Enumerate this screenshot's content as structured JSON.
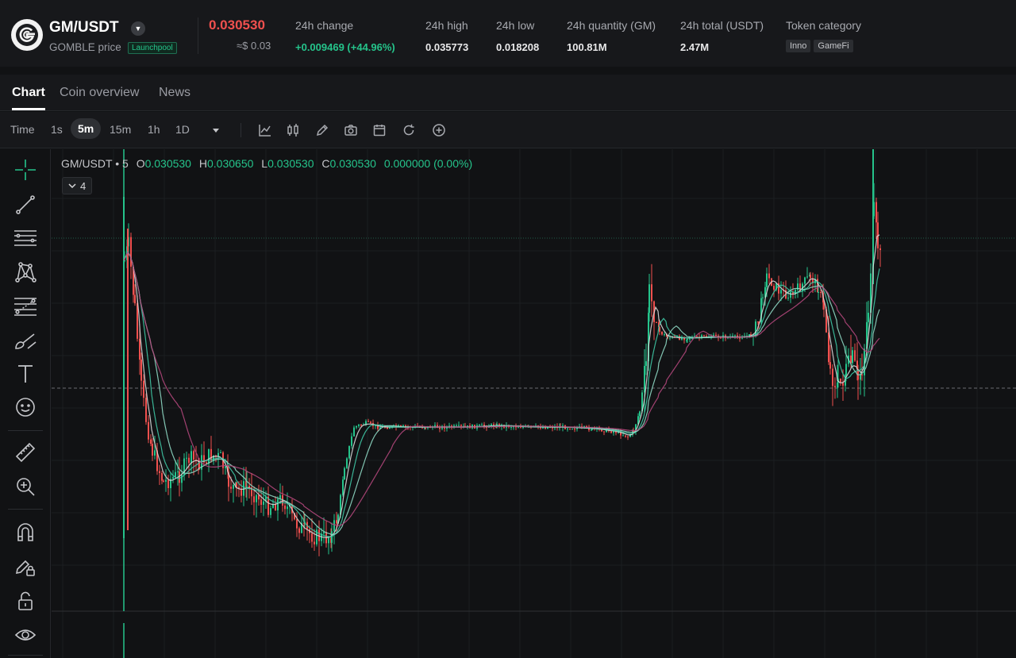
{
  "ticker": {
    "pair": "GM/USDT",
    "price_label": "GOMBLE price",
    "badge": "Launchpool",
    "last_price": "0.030530",
    "usd_price": "≈$ 0.03",
    "stats": [
      {
        "label": "24h change",
        "value": "+0.009469 (+44.96%)",
        "up": true
      },
      {
        "label": "24h high",
        "value": "0.035773"
      },
      {
        "label": "24h low",
        "value": "0.018208"
      },
      {
        "label": "24h quantity (GM)",
        "value": "100.81M"
      },
      {
        "label": "24h total (USDT)",
        "value": "2.47M"
      }
    ],
    "category_label": "Token category",
    "category_tags": [
      "Inno",
      "GameFi"
    ]
  },
  "tabs": [
    {
      "label": "Chart",
      "active": true
    },
    {
      "label": "Coin overview"
    },
    {
      "label": "News"
    }
  ],
  "toolbar": {
    "time_label": "Time",
    "intervals": [
      "1s",
      "5m",
      "15m",
      "1h",
      "1D"
    ],
    "active_interval": "5m",
    "icons": [
      "indicators-icon",
      "candle-type-icon",
      "pencil-icon",
      "camera-icon",
      "calendar-icon",
      "refresh-icon",
      "add-icon"
    ]
  },
  "left_tools": [
    "crosshair-icon",
    "trend-line-icon",
    "horizontal-lines-icon",
    "pattern-icon",
    "fib-icon",
    "brush-icon",
    "text-icon",
    "emoji-icon",
    "ruler-icon",
    "zoom-in-icon",
    "magnet-icon",
    "lock-drawing-icon",
    "unlock-icon",
    "eye-icon"
  ],
  "chart": {
    "symbol": "GM/USDT",
    "interval": "5",
    "open": "0.030530",
    "high": "0.030650",
    "low": "0.030530",
    "close": "0.030530",
    "change": "0.000000 (0.00%)",
    "indicator_count": "4"
  },
  "colors": {
    "up": "#25c48b",
    "down": "#f0504e",
    "ma_fast": "#d9d9d9",
    "ma_mid": "#3fc7a4",
    "ma_slow": "#b3477b"
  }
}
